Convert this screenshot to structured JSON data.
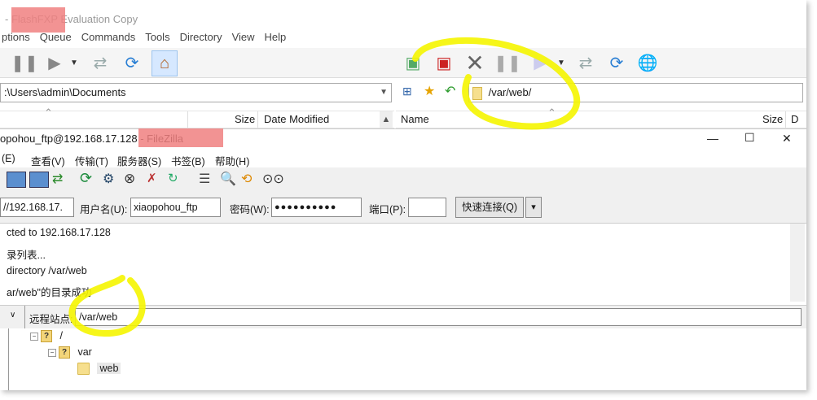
{
  "flashfxp": {
    "title": "FlashFXP Evaluation Copy",
    "menu": [
      "ptions",
      "Queue",
      "Commands",
      "Tools",
      "Directory",
      "View",
      "Help"
    ],
    "local_path": ":\\Users\\admin\\Documents",
    "remote_path": "/var/web/",
    "local_columns": [
      "Size",
      "Date Modified"
    ],
    "remote_columns": [
      "Name",
      "Size",
      "D"
    ]
  },
  "filezilla": {
    "title": "opohou_ftp@192.168.17.128 - FileZilla",
    "menu": [
      "(E)",
      "查看(V)",
      "传输(T)",
      "服务器(S)",
      "书签(B)",
      "帮助(H)"
    ],
    "window_controls": {
      "minimize": "—",
      "maximize": "☐",
      "close": "✕"
    },
    "quickconnect": {
      "host_value": "//192.168.17.",
      "user_label": "用户名(U):",
      "user_value": "xiaopohou_ftp",
      "password_label": "密码(W):",
      "password_value": "●●●●●●●●●●",
      "port_label": "端口(P):",
      "port_value": "",
      "connect_button": "快速连接(Q)",
      "dropdown": "▾"
    },
    "log": [
      "cted to 192.168.17.128",
      "录列表...",
      "directory /var/web",
      "ar/web\"的目录成功"
    ],
    "remote_site_label": "远程站点:",
    "remote_site_value": "/var/web",
    "tree": [
      "/",
      "var",
      "web"
    ]
  },
  "colors": {
    "highlight": "#f5f500",
    "redact": "#f08080"
  }
}
